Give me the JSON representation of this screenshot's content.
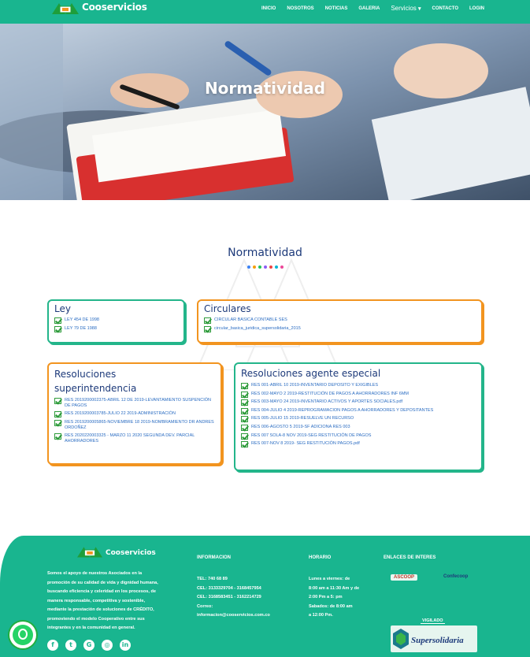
{
  "nav": {
    "brand": "Cooservicios",
    "items": [
      "INICIO",
      "NOSOTROS",
      "NOTICIAS",
      "GALERIA",
      "Servicios",
      "CONTACTO",
      "LOGIN"
    ],
    "services_caret": "▾"
  },
  "hero": {
    "title": "Normatividad"
  },
  "section": {
    "title": "Normatividad",
    "dot_colors": [
      "#3b82f6",
      "#f59e0b",
      "#22c55e",
      "#8b5cf6",
      "#ef4444",
      "#06b6d4",
      "#ec4899"
    ]
  },
  "cards": {
    "ley": {
      "title": "Ley",
      "items": [
        "LEY 454 DE 1998",
        "LEY 79 DE 1988"
      ]
    },
    "circulares": {
      "title": "Circulares",
      "items": [
        "CIRCULAR BASICA CONTABLE SES",
        "circular_basica_juridica_supersolidaria_2015"
      ]
    },
    "resoluciones": {
      "title_1": "Resoluciones",
      "title_2": "superintendencia",
      "items": [
        "RES 2019200002375-ABRIL 12 DE 2019-LEVANTAMIENTO SUSPENCIÓN DE PAGOS",
        "RES 2019200003785-JULIO 22 2019-ADMINISTRACIÓN",
        "RES 2019200005865-NOVIEMBRE 18 2019-NOMBRAMIENTO DR ANDRES ORDOÑEZ",
        "RES 2020220003325 - MARZO 11 2020 SEGUNDA DEV. PARCIAL AHORRADORES"
      ]
    },
    "agente": {
      "title": "Resoluciones agente especial",
      "items": [
        "RES 001-ABRIL 10 2019-INVENTARIO DEPOSITO Y EXIGIBLES",
        "RES 002-MAYO 2 2019-RESTITUCIÓN DE PAGOS A AHORRADORES INF 6MM",
        "RES 003-MAYO 24 2019-INVENTARIO ACTIVOS Y APORTES SOCIALES.pdf",
        "RES 004-JULIO 4 2019-REPROGRAMACION PAGOS A AHORRADORES Y DEPOSITANTES",
        "RES 005-JULIO 15 2019-RESUELVE UN RECURSO",
        "RES 006-AGOSTO 5 2019-SF ADICIONA RES 003",
        "RES 007 SOLA-8 NOV 2019-SEG RESTITUCIÓN DE PAGOS",
        "RES 007-NOV 8 2019- SEG RESTITUCIÓN PAGOS.pdf"
      ]
    }
  },
  "footer": {
    "brand": "Cooservicios",
    "about": [
      "Somos el apoyo de nuestros Asociados en la",
      "promoción de su calidad de vida y dignidad humana,",
      "buscando eficiencia y celeridad en los procesos, de",
      "manera responsable, competitiva y sostenible,",
      "mediante la prestación de soluciones de CRÉDITO,",
      "promoviendo el modelo Cooperativo entre sus",
      "integrantes y en la comunidad en general."
    ],
    "info_title": "INFORMACION",
    "info": [
      "TEL: 740 68 89",
      "CEL: 3133329704 - 3168457954",
      "CEL: 3168583451 - 3162214729",
      "Correo:",
      "informacion@cooservicios.com.co"
    ],
    "horario_title": "HORARIO",
    "horario": [
      "Lunes a viernes: de",
      "8:00 am a 11:30 Am y de",
      "2:00 Pm a 5: pm",
      "Sabados: de 8:00 am",
      "a 12:00 Pm."
    ],
    "links_title": "ENLACES DE INTERES",
    "partners": [
      "ASCOOP",
      "Confecoop"
    ],
    "vigilado": "VIGILADO",
    "supersolidaria": "Supersolidaria",
    "social_icons": [
      "facebook-icon",
      "twitter-icon",
      "google-plus-icon",
      "instagram-icon",
      "linkedin-icon"
    ]
  }
}
